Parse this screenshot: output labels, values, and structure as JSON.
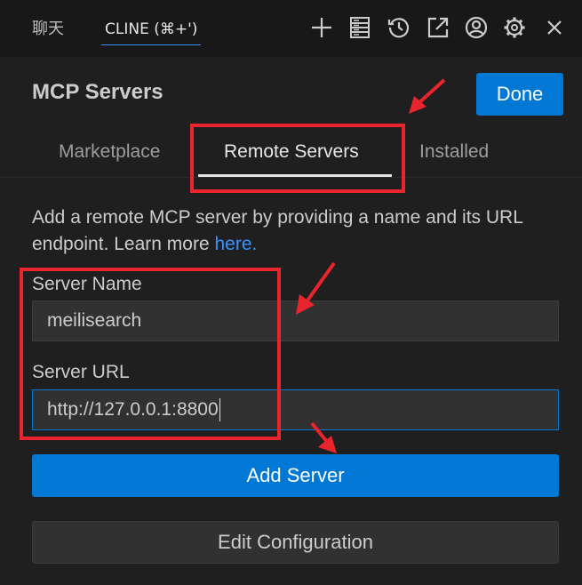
{
  "topbar": {
    "chat_tab": "聊天",
    "cline_tab": "CLINE (⌘+')",
    "icons": [
      "plus-icon",
      "server-list-icon",
      "history-icon",
      "open-external-icon",
      "account-icon",
      "settings-gear-icon",
      "close-icon"
    ]
  },
  "header": {
    "title": "MCP Servers",
    "done_label": "Done"
  },
  "tabs": [
    {
      "label": "Marketplace",
      "active": false
    },
    {
      "label": "Remote Servers",
      "active": true
    },
    {
      "label": "Installed",
      "active": false
    }
  ],
  "description": {
    "text": "Add a remote MCP server by providing a name and its URL endpoint. Learn more ",
    "link": "here."
  },
  "form": {
    "name_label": "Server Name",
    "name_value": "meilisearch",
    "url_label": "Server URL",
    "url_value": "http://127.0.0.1:8800",
    "add_label": "Add Server",
    "edit_label": "Edit Configuration"
  },
  "colors": {
    "accent": "#0078d4",
    "link": "#3794ff",
    "annotation": "#e8242c"
  }
}
